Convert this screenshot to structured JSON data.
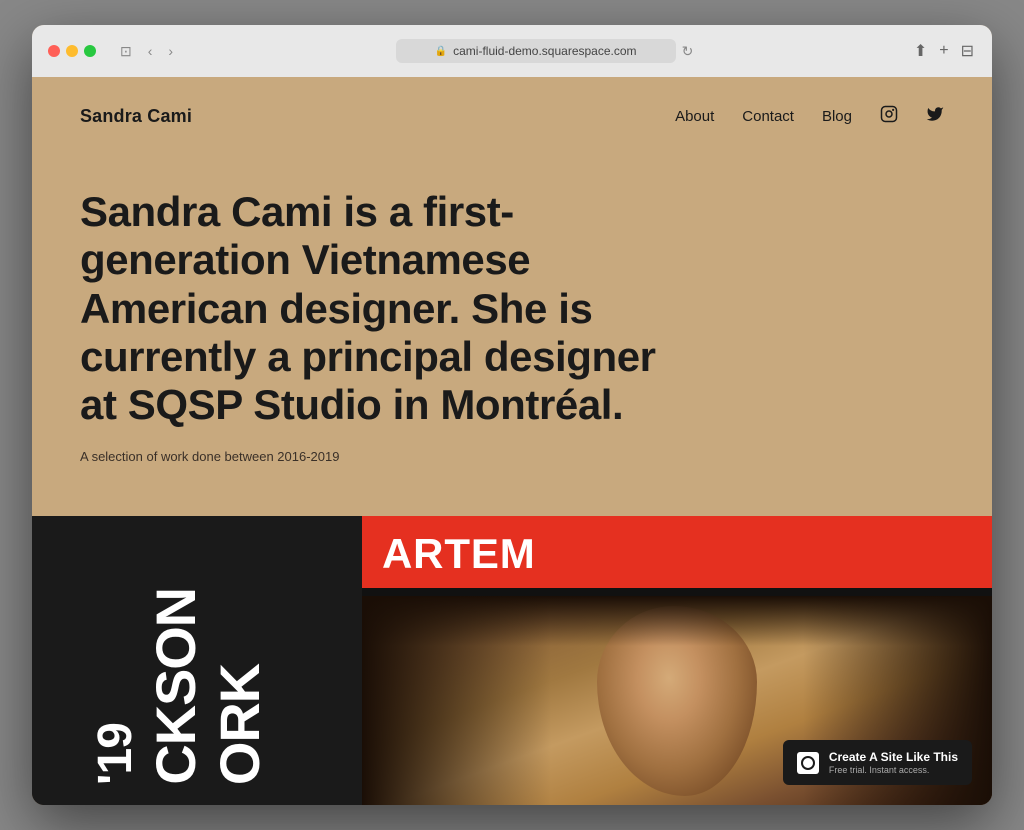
{
  "browser": {
    "url": "cami-fluid-demo.squarespace.com",
    "controls": {
      "back": "‹",
      "forward": "›",
      "window": "⊡",
      "refresh": "↻",
      "share": "⬆",
      "add": "+",
      "copy": "⊟"
    }
  },
  "site": {
    "logo": "Sandra Cami",
    "nav": {
      "about": "About",
      "contact": "Contact",
      "blog": "Blog",
      "instagram_icon": "instagram",
      "twitter_icon": "twitter"
    },
    "hero": {
      "headline": "Sandra Cami is a first-generation Vietnamese American designer. She is currently a principal designer at SQSP Studio in Montréal.",
      "subtext": "A selection of work done between 2016-2019"
    },
    "portfolio": {
      "left_card": {
        "text_lines": [
          "'19",
          "CKSON",
          "ORK"
        ]
      },
      "right_card": {
        "title": "ARTEM"
      }
    },
    "banner": {
      "main_text": "Create A Site Like This",
      "sub_text": "Free trial. Instant access."
    }
  }
}
